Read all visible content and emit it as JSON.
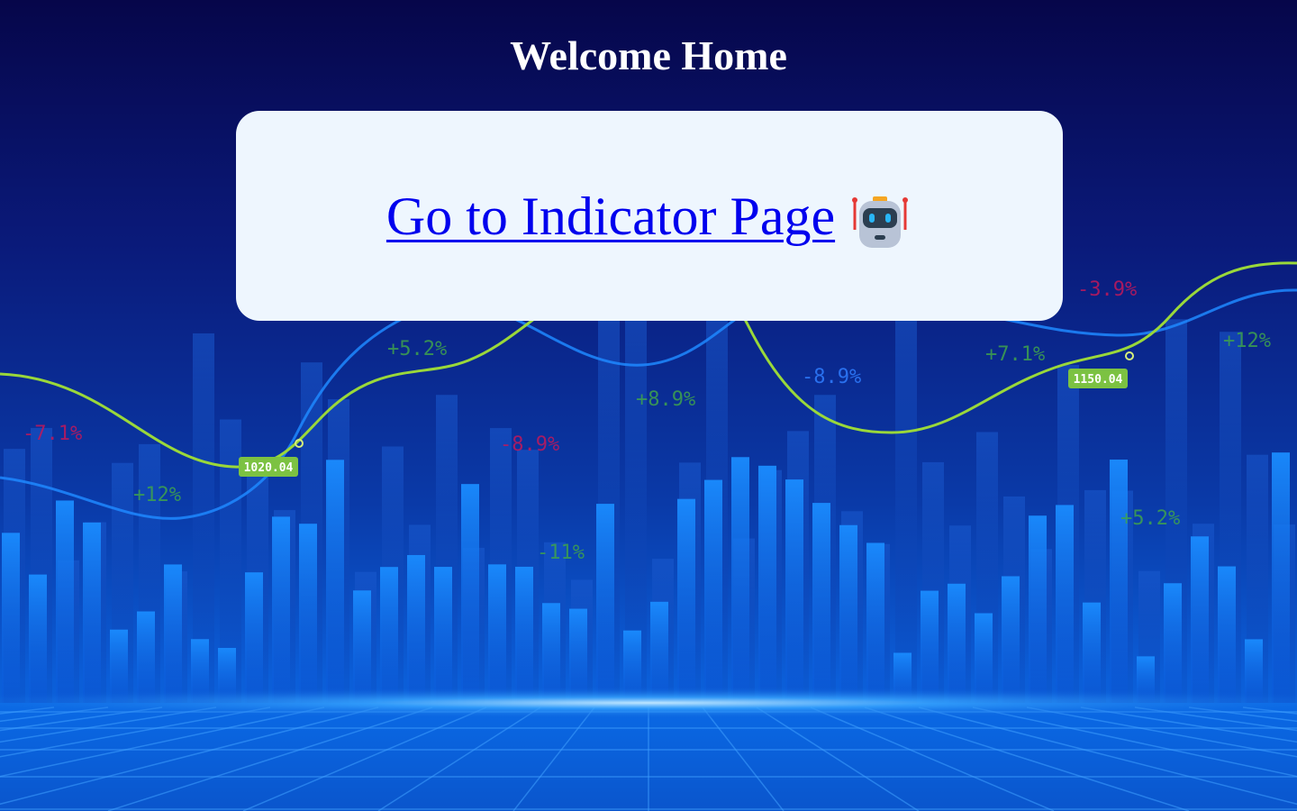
{
  "page": {
    "title": "Welcome Home"
  },
  "card": {
    "link_label": "Go to Indicator Page",
    "link_icon": "robot-icon"
  },
  "background": {
    "price_tags": [
      "1020.04",
      "1150.04"
    ],
    "percent_labels": [
      {
        "text": "-7.1%",
        "color": "#c2185b"
      },
      {
        "text": "+12%",
        "color": "#3fa34d"
      },
      {
        "text": "+5.2%",
        "color": "#3fa34d"
      },
      {
        "text": "-8.9%",
        "color": "#c2185b"
      },
      {
        "text": "+8.9%",
        "color": "#3fa34d"
      },
      {
        "text": "-11%",
        "color": "#3fa34d"
      },
      {
        "text": "-8.9%",
        "color": "#2f7dff"
      },
      {
        "text": "+7.1%",
        "color": "#3fa34d"
      },
      {
        "text": "-3.9%",
        "color": "#c2185b"
      },
      {
        "text": "+12%",
        "color": "#3fa34d"
      },
      {
        "text": "+5.2%",
        "color": "#3fa34d"
      }
    ]
  },
  "colors": {
    "link": "#0000ee",
    "card_bg": "#eef6fe",
    "title": "#ffffff"
  }
}
